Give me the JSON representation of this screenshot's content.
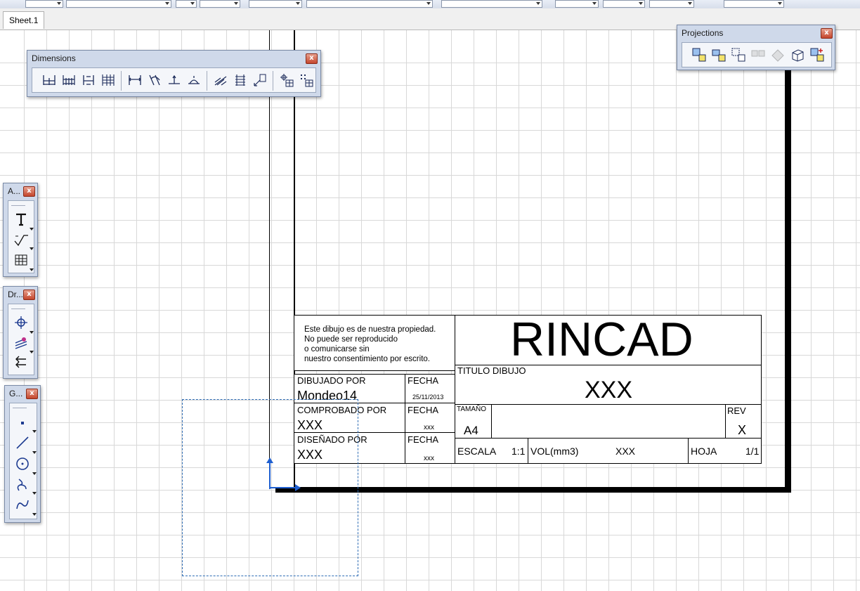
{
  "tabs": {
    "sheet": "Sheet.1"
  },
  "palettes": {
    "dimensions": {
      "title": "Dimensions"
    },
    "projections": {
      "title": "Projections"
    },
    "annotation": {
      "title": "A..."
    },
    "dress": {
      "title": "Dr..."
    },
    "geometry": {
      "title": "G..."
    },
    "close_glyph": "x"
  },
  "title_block": {
    "notice_lines": [
      "Este dibujo es de nuestra propiedad.",
      "No puede ser reproducido",
      "o comunicarse sin",
      "nuestro consentimiento por escrito."
    ],
    "company": "RINCAD",
    "titulo_label": "TITULO DIBUJO",
    "titulo_value": "XXX",
    "dibujado_label": "DIBUJADO POR",
    "dibujado_value": "Mondeo14",
    "fecha_label": "FECHA",
    "fecha1_value": "25/11/2013",
    "comprobado_label": "COMPROBADO POR",
    "comprobado_value": "XXX",
    "fecha2_value": "xxx",
    "disenado_label": "DISEÑADO POR",
    "disenado_value": "XXX",
    "fecha3_value": "xxx",
    "tamano_label": "TAMAÑO",
    "tamano_value": "A4",
    "rev_label": "REV",
    "rev_value": "X",
    "escala_label": "ESCALA",
    "escala_value": "1:1",
    "vol_label": "VOL(mm3)",
    "vol_value": "XXX",
    "hoja_label": "HOJA",
    "hoja_value": "1/1"
  },
  "icons": {
    "dimensions": [
      "cumulated-dimensions-icon",
      "stacked-dimensions-icon",
      "chained-dimensions-icon",
      "stacked-chain-icon",
      "length-dimension-icon",
      "angle-dimension-icon",
      "radius-dimension-icon",
      "diameter-dimension-icon",
      "chamfer-dimension-icon",
      "thread-dimension-icon",
      "coordinate-dimension-icon",
      "hole-table-icon",
      "point-table-icon"
    ],
    "projections": [
      "front-view-icon",
      "unfolded-view-icon",
      "view-from-3d-icon",
      "projection-view-icon",
      "auxiliary-view-icon",
      "isometric-view-icon",
      "advanced-front-view-icon"
    ],
    "annotation": [
      "text-icon",
      "roughness-symbol-icon",
      "table-icon"
    ],
    "dress": [
      "center-line-icon",
      "area-fill-icon",
      "arrow-icon"
    ],
    "geometry": [
      "point-icon",
      "line-icon",
      "circle-icon",
      "spline-icon",
      "curve-icon"
    ]
  }
}
